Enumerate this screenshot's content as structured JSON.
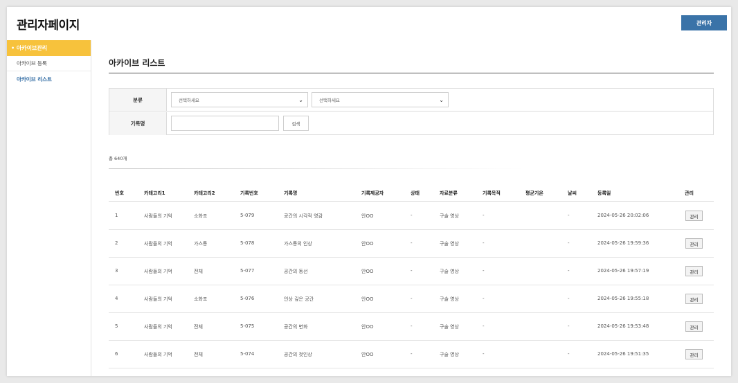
{
  "header": {
    "title": "관리자페이지",
    "admin_button": "관리자"
  },
  "sidebar": {
    "section": "• 아카이브관리",
    "items": [
      {
        "label": "아카이브 등록"
      },
      {
        "label": "아카이브 리스트"
      }
    ]
  },
  "main": {
    "page_title": "아카이브 리스트",
    "filter": {
      "category_label": "분류",
      "select1_value": "선택하세요",
      "select2_value": "선택하세요",
      "record_label": "기록명",
      "record_value": "",
      "search_button": "검색"
    },
    "total_text": "총 640개",
    "table": {
      "headers": [
        "번호",
        "카테고리1",
        "카테고리2",
        "기록번호",
        "기록명",
        "기록제공자",
        "상태",
        "자료분류",
        "기록목적",
        "평균기온",
        "날씨",
        "등록일",
        "관리"
      ],
      "rows": [
        {
          "no": "1",
          "cat1": "사람들의 기억",
          "cat2": "소화조",
          "code": "5-079",
          "name": "공간의 시각적 영감",
          "provider": "안OO",
          "status": "-",
          "type": "구술 영상",
          "purpose": "-",
          "temp": "",
          "weather": "-",
          "date": "2024-05-26 20:02:06",
          "manage": "관리"
        },
        {
          "no": "2",
          "cat1": "사람들의 기억",
          "cat2": "가스통",
          "code": "5-078",
          "name": "가스통의 인상",
          "provider": "안OO",
          "status": "-",
          "type": "구술 영상",
          "purpose": "-",
          "temp": "",
          "weather": "-",
          "date": "2024-05-26 19:59:36",
          "manage": "관리"
        },
        {
          "no": "3",
          "cat1": "사람들의 기억",
          "cat2": "전체",
          "code": "5-077",
          "name": "공간의 동선",
          "provider": "안OO",
          "status": "-",
          "type": "구술 영상",
          "purpose": "-",
          "temp": "",
          "weather": "-",
          "date": "2024-05-26 19:57:19",
          "manage": "관리"
        },
        {
          "no": "4",
          "cat1": "사람들의 기억",
          "cat2": "소화조",
          "code": "5-076",
          "name": "인상 깊은 공간",
          "provider": "안OO",
          "status": "-",
          "type": "구술 영상",
          "purpose": "-",
          "temp": "",
          "weather": "-",
          "date": "2024-05-26 19:55:18",
          "manage": "관리"
        },
        {
          "no": "5",
          "cat1": "사람들의 기억",
          "cat2": "전체",
          "code": "5-075",
          "name": "공간의 변화",
          "provider": "안OO",
          "status": "-",
          "type": "구술 영상",
          "purpose": "-",
          "temp": "",
          "weather": "-",
          "date": "2024-05-26 19:53:48",
          "manage": "관리"
        },
        {
          "no": "6",
          "cat1": "사람들의 기억",
          "cat2": "전체",
          "code": "5-074",
          "name": "공간의 첫인상",
          "provider": "안OO",
          "status": "-",
          "type": "구술 영상",
          "purpose": "-",
          "temp": "",
          "weather": "-",
          "date": "2024-05-26 19:51:35",
          "manage": "관리"
        }
      ]
    }
  },
  "colors": {
    "accent_blue": "#3a73a8",
    "sidebar_active": "#f7c23c",
    "link_blue": "#2f6aa3"
  }
}
